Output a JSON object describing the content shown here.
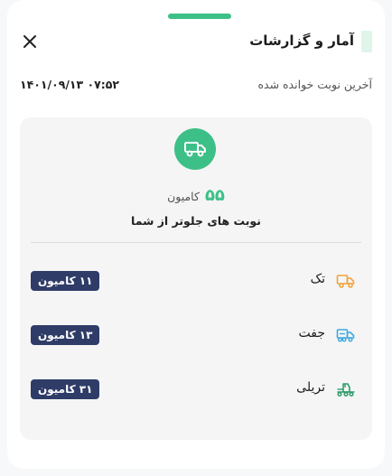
{
  "colors": {
    "accent": "#3cc087",
    "badge": "#2f3c68",
    "single_truck": "#f2a33a",
    "double_truck": "#3fa9e0",
    "trailer_truck": "#2e9c6a"
  },
  "header": {
    "title": "آمار و گزارشات",
    "close_icon": "close-icon"
  },
  "meta": {
    "last_turn_label": "آخرین نوبت خوانده شده",
    "last_turn_value": "۱۴۰۱/۰۹/۱۳ ۰۷:۵۲"
  },
  "summary": {
    "icon": "truck-icon",
    "count": "۵۵",
    "unit": "کامیون",
    "caption": "نوبت های جلوتر از شما"
  },
  "rows": [
    {
      "label": "تک",
      "icon": "single-truck-icon",
      "badge": "۱۱ کامیون"
    },
    {
      "label": "جفت",
      "icon": "double-truck-icon",
      "badge": "۱۳ کامیون"
    },
    {
      "label": "تریلی",
      "icon": "trailer-truck-icon",
      "badge": "۳۱ کامیون"
    }
  ]
}
